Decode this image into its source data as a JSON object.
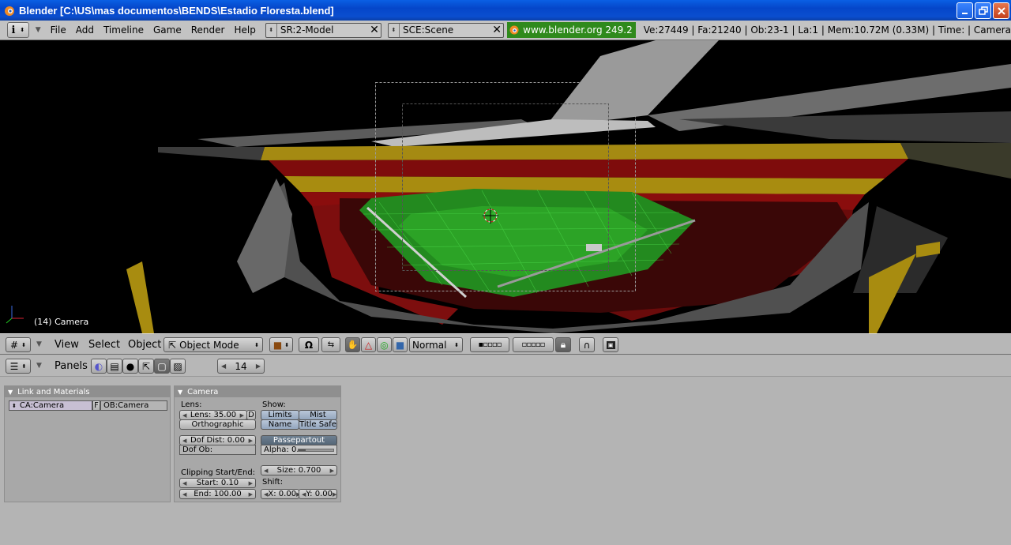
{
  "window": {
    "title": "Blender [C:\\US\\mas documentos\\BENDS\\Estadio Floresta.blend]",
    "buttons": [
      "minimize",
      "maximize",
      "close"
    ]
  },
  "info_header": {
    "menus": [
      "File",
      "Add",
      "Timeline",
      "Game",
      "Render",
      "Help"
    ],
    "screen_field": "SR:2-Model",
    "scene_field": "SCE:Scene",
    "blender_link": "www.blender.org 249.2",
    "stats": "Ve:27449 | Fa:21240 | Ob:23-1 | La:1 | Mem:10.72M (0.33M) | Time: | Camera"
  },
  "viewport": {
    "object_label": "(14) Camera",
    "colors": {
      "pitch": "#2f8f2a",
      "seats_red": "#8a0d0d",
      "seats_yellow": "#a88c10",
      "structure": "#7a7a7a"
    }
  },
  "view3d_header": {
    "menus": [
      "View",
      "Select",
      "Object"
    ],
    "mode": "Object Mode",
    "pivot_select": "Normal"
  },
  "buttons_header": {
    "label": "Panels",
    "frame": "14"
  },
  "link_materials_panel": {
    "title": "Link and Materials",
    "camera_data": "CA:Camera",
    "fake_user": "F",
    "object_name": "OB:Camera"
  },
  "camera_panel": {
    "title": "Camera",
    "lens_label": "Lens:",
    "lens_value": "Lens: 35.00",
    "lens_toggle": "D",
    "orthographic": "Orthographic",
    "dof_dist": "Dof Dist: 0.00",
    "dof_ob": "Dof Ob:",
    "clipping_label": "Clipping Start/End:",
    "clip_start": "Start: 0.10",
    "clip_end": "End: 100.00",
    "show_label": "Show:",
    "limits": "Limits",
    "mist": "Mist",
    "name": "Name",
    "title_safe": "Title Safe",
    "passepartout": "Passepartout",
    "alpha": "Alpha: 0.",
    "alpha_level": 0.2,
    "size": "Size: 0.700",
    "shift_label": "Shift:",
    "shift_x": "X: 0.00",
    "shift_y": "Y: 0.00"
  }
}
